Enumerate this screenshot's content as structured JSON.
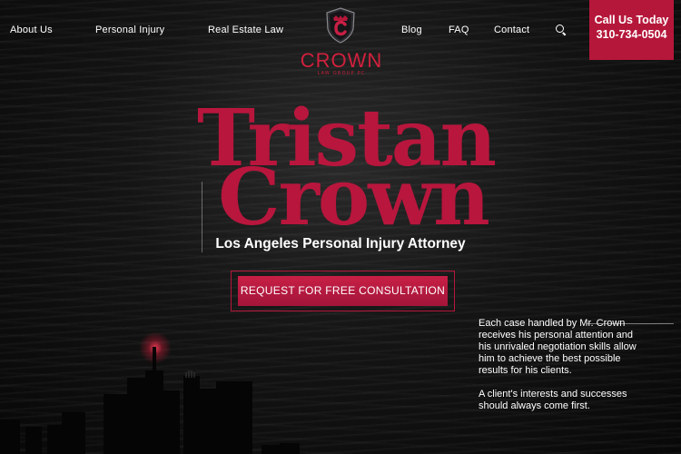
{
  "nav": {
    "left_items": [
      "About Us",
      "Personal Injury",
      "Real Estate Law"
    ],
    "right_items": [
      "Blog",
      "FAQ",
      "Contact"
    ]
  },
  "logo": {
    "brand": "CROWN",
    "subtitle": "LAW GROUP PC"
  },
  "call": {
    "line1": "Call Us Today",
    "phone": "310-734-0504"
  },
  "hero": {
    "title_line1": "Tristan",
    "title_line2": "Crown",
    "subtitle": "Los Angeles Personal Injury Attorney",
    "cta_label": "REQUEST FOR FREE CONSULTATION"
  },
  "side": {
    "paragraph1": "Each case handled by Mr. Crown receives his personal attention and his unrivaled negotiation skills allow him to achieve the best possible results for his clients.",
    "paragraph2": "A client's interests and successes should always come first."
  },
  "icons": {
    "search": "search-icon",
    "logo_shield": "shield-logo-icon"
  },
  "colors": {
    "accent": "#b5173a",
    "title": "#b8163d",
    "background": "#0b0b0b"
  }
}
